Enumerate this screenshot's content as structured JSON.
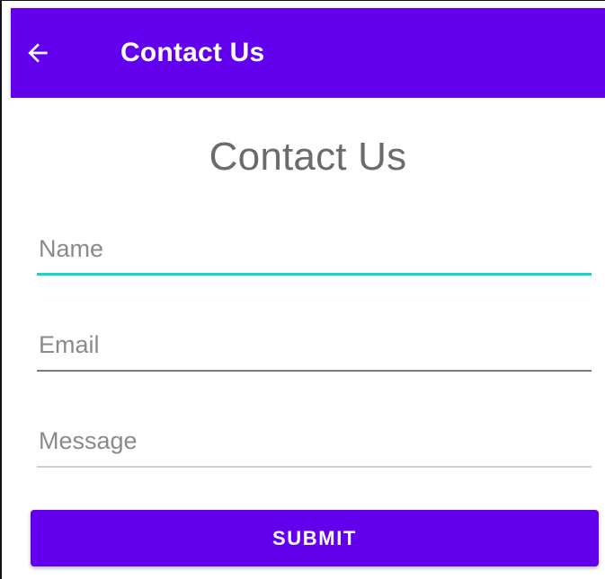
{
  "app_bar": {
    "title": "Contact Us",
    "back_icon": "arrow-back-icon",
    "background_color": "#6200ee",
    "text_color": "#ffffff"
  },
  "page": {
    "heading": "Contact Us"
  },
  "form": {
    "fields": [
      {
        "id": "name",
        "value": "",
        "placeholder": "Name",
        "state": "focused",
        "underline_color": "#14d6c7"
      },
      {
        "id": "email",
        "value": "",
        "placeholder": "Email",
        "state": "default",
        "underline_color": "#7a7a7a"
      },
      {
        "id": "message",
        "value": "",
        "placeholder": "Message",
        "state": "default",
        "underline_color": "#cfcfcf"
      }
    ],
    "submit_label": "SUBMIT",
    "submit_color": "#6200ee"
  }
}
